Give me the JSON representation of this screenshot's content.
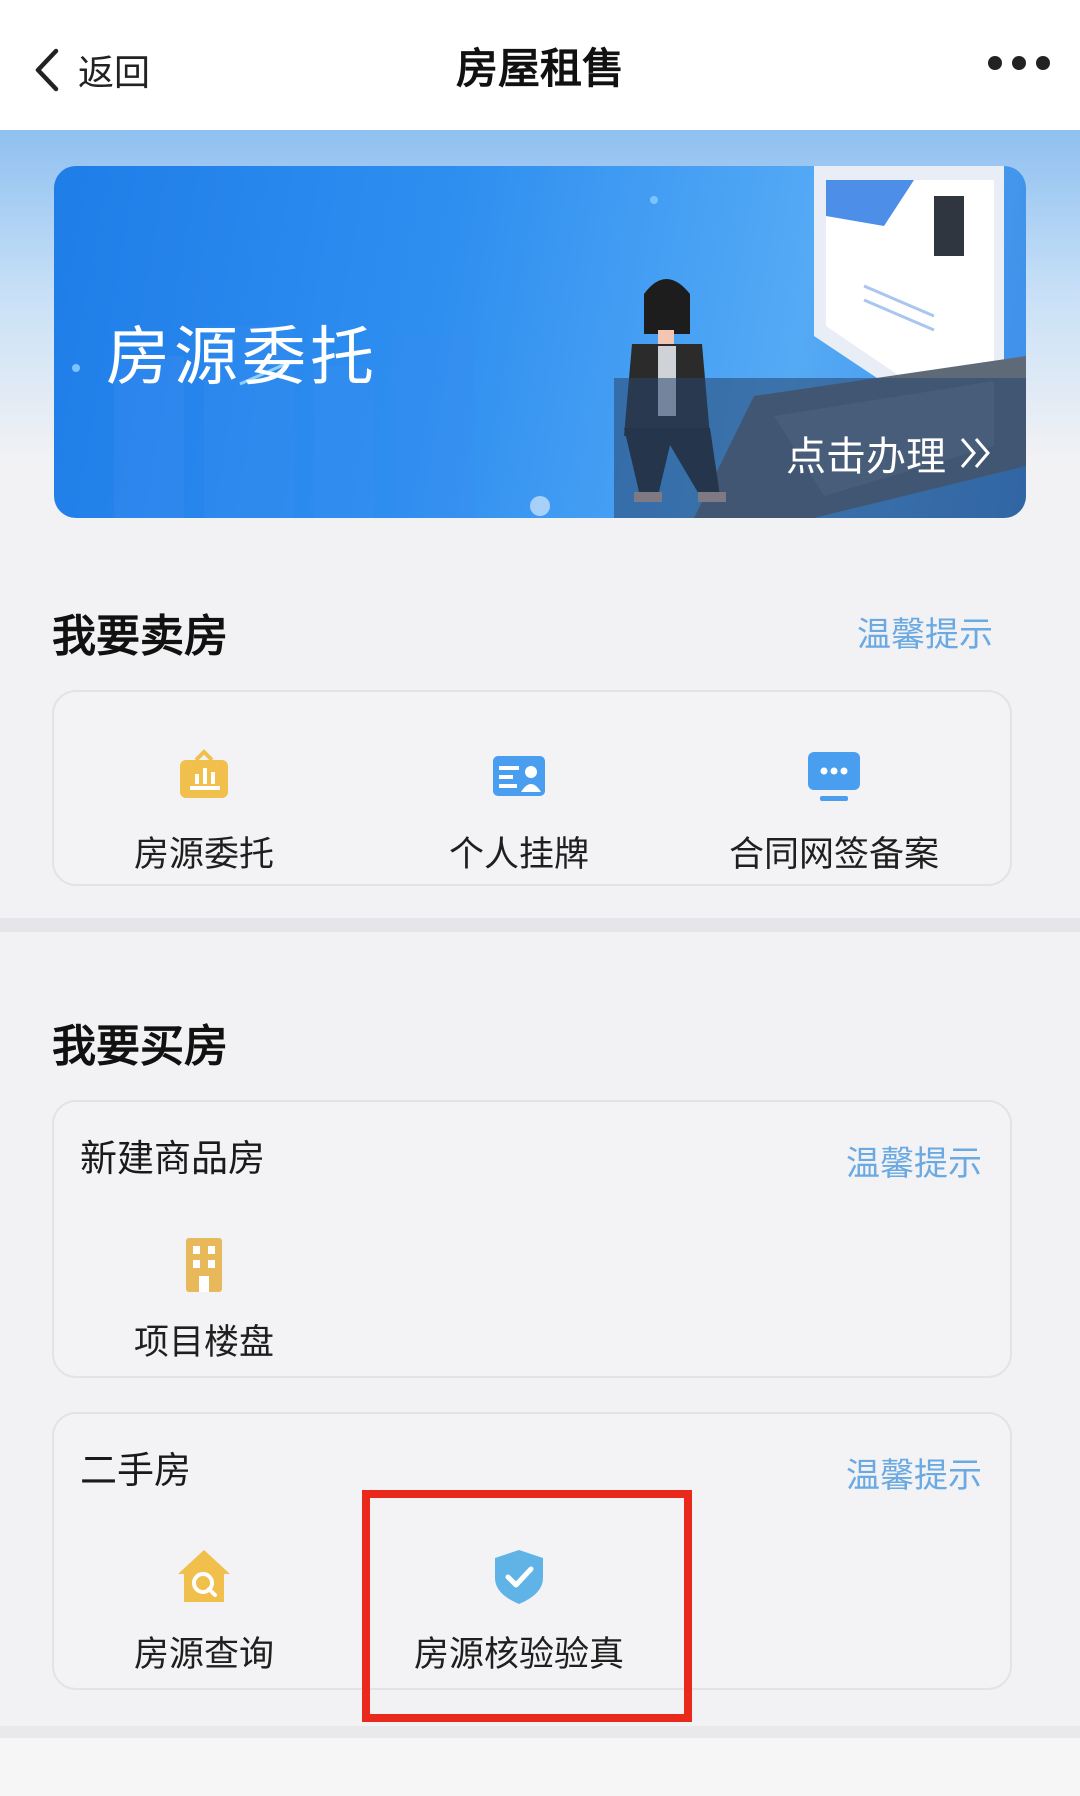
{
  "nav": {
    "back_label": "返回",
    "title": "房屋租售"
  },
  "banner": {
    "title": "房源委托",
    "cta_label": "点击办理"
  },
  "sell": {
    "heading": "我要卖房",
    "tip_label": "温馨提示",
    "items": [
      {
        "label": "房源委托",
        "icon": "entrust-icon"
      },
      {
        "label": "个人挂牌",
        "icon": "id-card-icon"
      },
      {
        "label": "合同网签备案",
        "icon": "monitor-chat-icon"
      }
    ]
  },
  "buy": {
    "heading": "我要买房",
    "new_homes": {
      "title": "新建商品房",
      "tip_label": "温馨提示",
      "items": [
        {
          "label": "项目楼盘",
          "icon": "building-icon"
        }
      ]
    },
    "second_hand": {
      "title": "二手房",
      "tip_label": "温馨提示",
      "items": [
        {
          "label": "房源查询",
          "icon": "house-search-icon"
        },
        {
          "label": "房源核验验真",
          "icon": "shield-check-icon"
        }
      ]
    }
  },
  "colors": {
    "accent_link": "#6aa9e2",
    "banner_blue": "#2f8ff0",
    "icon_gold": "#f0bf4c",
    "icon_blue": "#4a9ef0",
    "highlight_red": "#e8291c"
  }
}
